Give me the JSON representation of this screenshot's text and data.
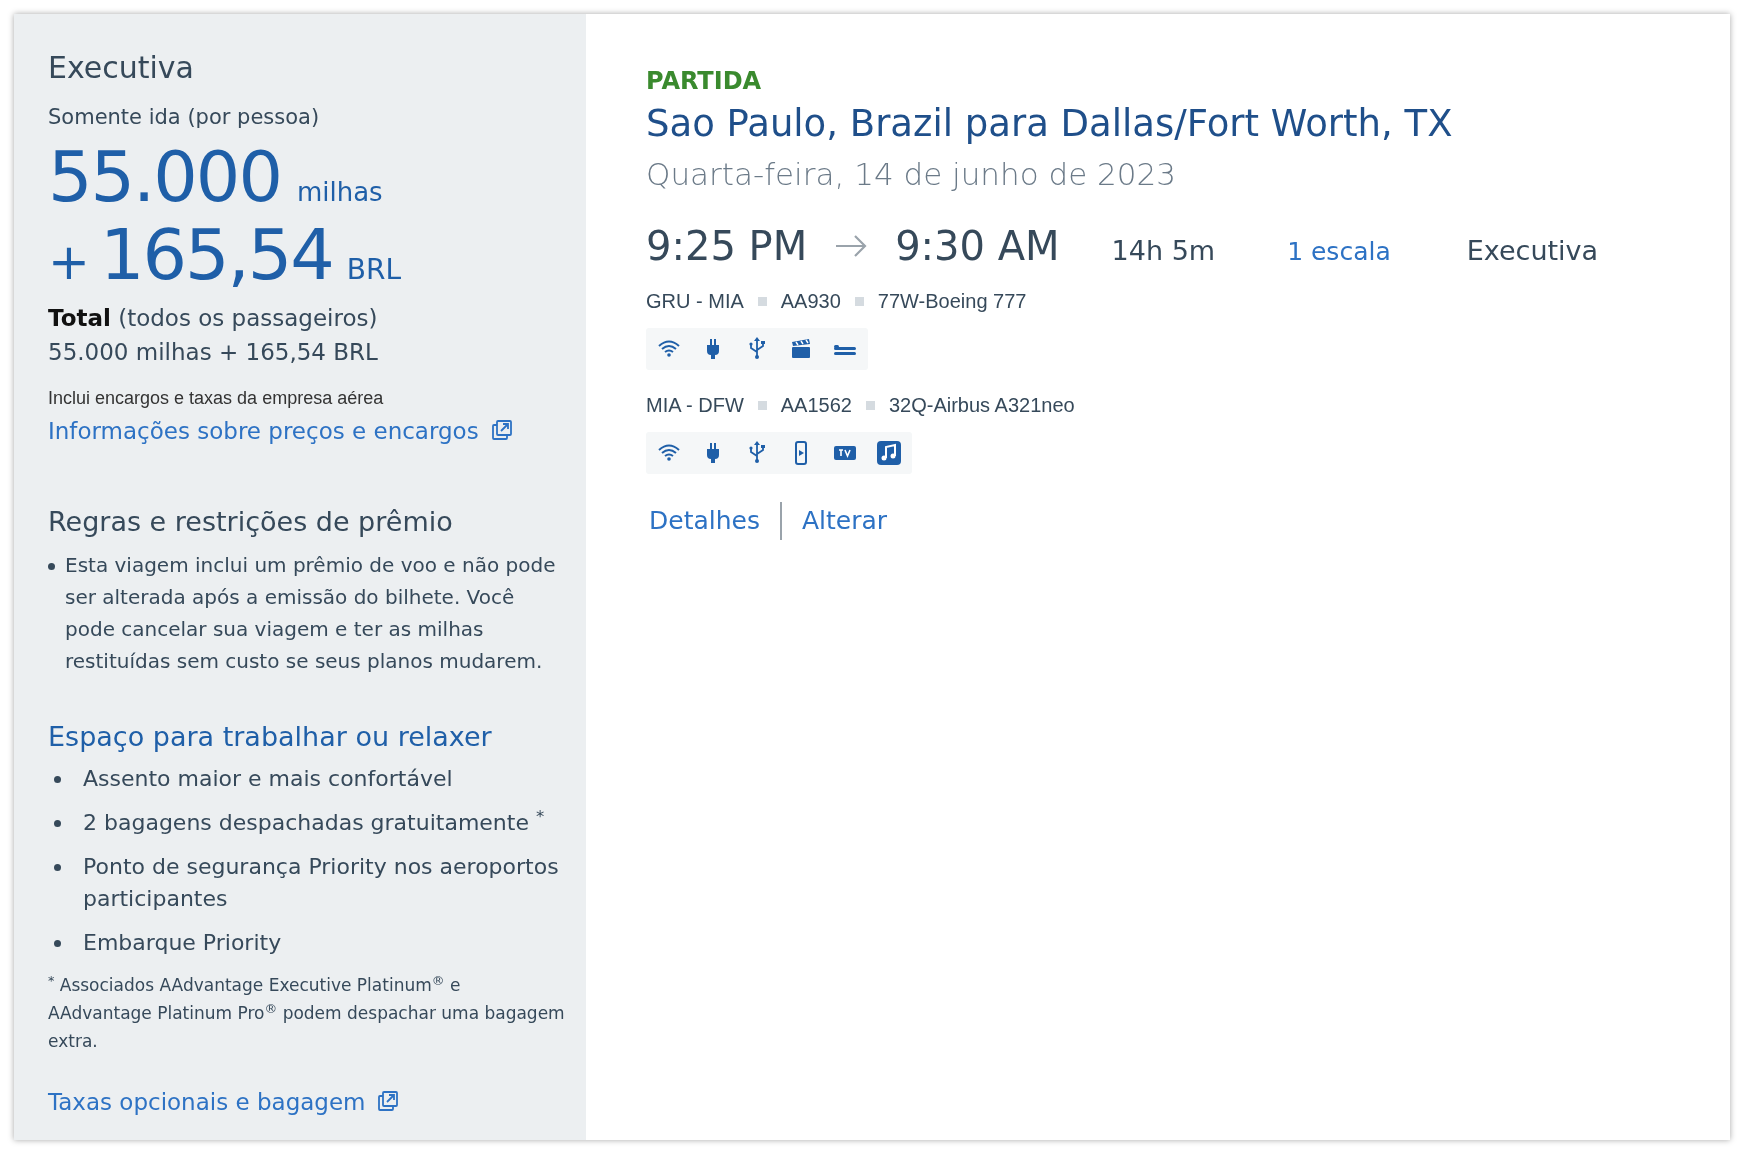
{
  "fare": {
    "cabin": "Executiva",
    "trip_type": "Somente ida (por pessoa)",
    "miles": "55.000",
    "miles_unit": "milhas",
    "plus": "+",
    "amount": "165,54",
    "currency": "BRL",
    "total_label": "Total",
    "total_note": "(todos os passageiros)",
    "total_value": "55.000 milhas + 165,54 BRL",
    "includes": "Inclui encargos e taxas da empresa aérea",
    "info_link": "Informações sobre preços e encargos"
  },
  "rules": {
    "title": "Regras e restrições de prêmio",
    "items": [
      "Esta viagem inclui um prêmio de voo e não pode ser alterada após a emissão do bilhete. Você pode cancelar sua viagem e ter as milhas restituídas sem custo se seus planos mudarem."
    ]
  },
  "benefits": {
    "title": "Espaço para trabalhar ou relaxer",
    "items": [
      "Assento maior e mais confortável",
      "2 bagagens despachadas gratuitamente $^{*}$",
      "Ponto de segurança Priority nos aeroportos participantes",
      "Embarque Priority"
    ],
    "footnote": "$^{*}$ Associados AAdvantage Executive Platinum$^{®}$ e AAdvantage Platinum Pro$^{®}$ podem despachar uma bagagem extra.",
    "link": "Taxas opcionais e bagagem"
  },
  "flight": {
    "label": "PARTIDA",
    "route": "Sao Paulo, Brazil para Dallas/Fort Worth, TX",
    "date": "Quarta-feira, 14 de junho de 2023",
    "depart": "9:25 PM",
    "arrive": "9:30 AM",
    "duration": "14h 5m",
    "stops": "1 escala",
    "cabin": "Executiva",
    "segments": [
      {
        "route": "GRU - MIA",
        "flight": "AA930",
        "aircraft": "77W-Boeing 777",
        "amenities": [
          {
            "kind": "wifi"
          },
          {
            "kind": "power"
          },
          {
            "kind": "usb"
          },
          {
            "kind": "video"
          },
          {
            "kind": "seat"
          }
        ]
      },
      {
        "route": "MIA - DFW",
        "flight": "AA1562",
        "aircraft": "32Q-Airbus A321neo",
        "amenities": [
          {
            "kind": "wifi"
          },
          {
            "kind": "power"
          },
          {
            "kind": "usb"
          },
          {
            "kind": "phone"
          },
          {
            "kind": "tv"
          },
          {
            "kind": "music"
          }
        ]
      }
    ],
    "links": [
      "Detalhes",
      "Alterar"
    ]
  }
}
